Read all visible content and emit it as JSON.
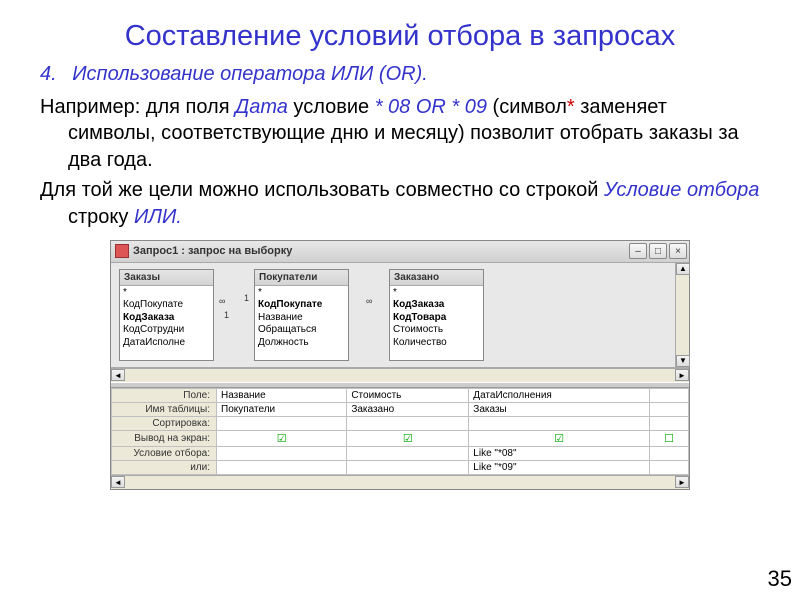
{
  "title": "Составление условий отбора в запросах",
  "list_item": {
    "num": "4.",
    "text": "Использование оператора ИЛИ (OR)."
  },
  "para1": {
    "p1": "Например: для поля ",
    "p1h": "Дата",
    "p2": " условие ",
    "p2h": "* 08 OR * 09",
    "p3": " (символ",
    "p3a": "*",
    "p4": " заменяет символы, соответствующие дню и месяцу) позволит отобрать заказы за два года."
  },
  "para2": {
    "p1": "Для той же цели можно использовать совместно со строкой ",
    "p1h": "Условие отбора",
    "p2": " строку ",
    "p2h": "ИЛИ."
  },
  "window": {
    "title": "Запрос1 : запрос на выборку",
    "tables": [
      {
        "name": "Заказы",
        "rows": [
          "*",
          "КодПокупате",
          "КодЗаказа",
          "КодСотрудни",
          "ДатаИсполне"
        ],
        "bold_idx": [
          2
        ]
      },
      {
        "name": "Покупатели",
        "rows": [
          "*",
          "КодПокупате",
          "Название",
          "Обращаться",
          "Должность"
        ],
        "bold_idx": [
          1
        ]
      },
      {
        "name": "Заказано",
        "rows": [
          "*",
          "КодЗаказа",
          "КодТовара",
          "Стоимость",
          "Количество"
        ],
        "bold_idx": [
          1,
          2
        ]
      }
    ],
    "rel": {
      "inf": "∞",
      "one": "1"
    },
    "grid": {
      "labels": [
        "Поле:",
        "Имя таблицы:",
        "Сортировка:",
        "Вывод на экран:",
        "Условие отбора:",
        "или:"
      ],
      "cols": [
        {
          "field": "Название",
          "table": "Покупатели",
          "show": true,
          "crit": "",
          "or": ""
        },
        {
          "field": "Стоимость",
          "table": "Заказано",
          "show": true,
          "crit": "",
          "or": ""
        },
        {
          "field": "ДатаИсполнения",
          "table": "Заказы",
          "show": true,
          "crit": "Like \"*08\"",
          "or": "Like \"*09\""
        },
        {
          "field": "",
          "table": "",
          "show": false,
          "crit": "",
          "or": ""
        }
      ]
    }
  },
  "page_num": "35"
}
